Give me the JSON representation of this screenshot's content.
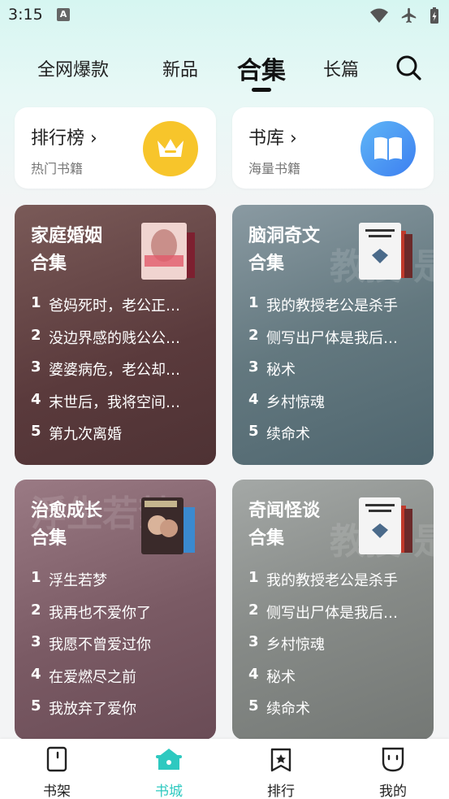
{
  "status": {
    "time": "3:15",
    "indicator": "A"
  },
  "tabs": [
    {
      "label": "全网爆款"
    },
    {
      "label": "新品"
    },
    {
      "label": "合集"
    },
    {
      "label": "长篇"
    }
  ],
  "quick": [
    {
      "title": "排行榜",
      "subtitle": "热门书籍",
      "icon": "crown-icon",
      "color": "#f7c52b"
    },
    {
      "title": "书库",
      "subtitle": "海量书籍",
      "icon": "book-icon",
      "color": "#3f8ff3"
    }
  ],
  "collections": [
    {
      "title_line1": "家庭婚姻",
      "title_line2": "合集",
      "items": [
        "爸妈死时，老公正…",
        "没边界感的贱公公…",
        "婆婆病危，老公却…",
        "末世后，我将空间…",
        "第九次离婚"
      ],
      "color": "#5a3a3c"
    },
    {
      "title_line1": "脑洞奇文",
      "title_line2": "合集",
      "items": [
        "我的教授老公是杀手",
        "侧写出尸体是我后…",
        "秘术",
        "乡村惊魂",
        "续命术"
      ],
      "color": "#58707a",
      "bg_text": "教授 是杀手"
    },
    {
      "title_line1": "治愈成长",
      "title_line2": "合集",
      "items": [
        "浮生若梦",
        "我再也不爱你了",
        "我愿不曾爱过你",
        "在爱燃尽之前",
        "我放弃了爱你"
      ],
      "color": "#7a5a64",
      "bg_text": "浮生若梦"
    },
    {
      "title_line1": "奇闻怪谈",
      "title_line2": "合集",
      "items": [
        "我的教授老公是杀手",
        "侧写出尸体是我后…",
        "乡村惊魂",
        "秘术",
        "续命术"
      ],
      "color": "#7c807d",
      "bg_text": "教授 是杀手"
    }
  ],
  "bottom_nav": [
    {
      "label": "书架",
      "icon": "bookshelf-icon"
    },
    {
      "label": "书城",
      "icon": "bookstore-icon",
      "active": true
    },
    {
      "label": "排行",
      "icon": "ranking-icon"
    },
    {
      "label": "我的",
      "icon": "profile-icon"
    }
  ],
  "colors": {
    "accent": "#2ec9c0"
  }
}
